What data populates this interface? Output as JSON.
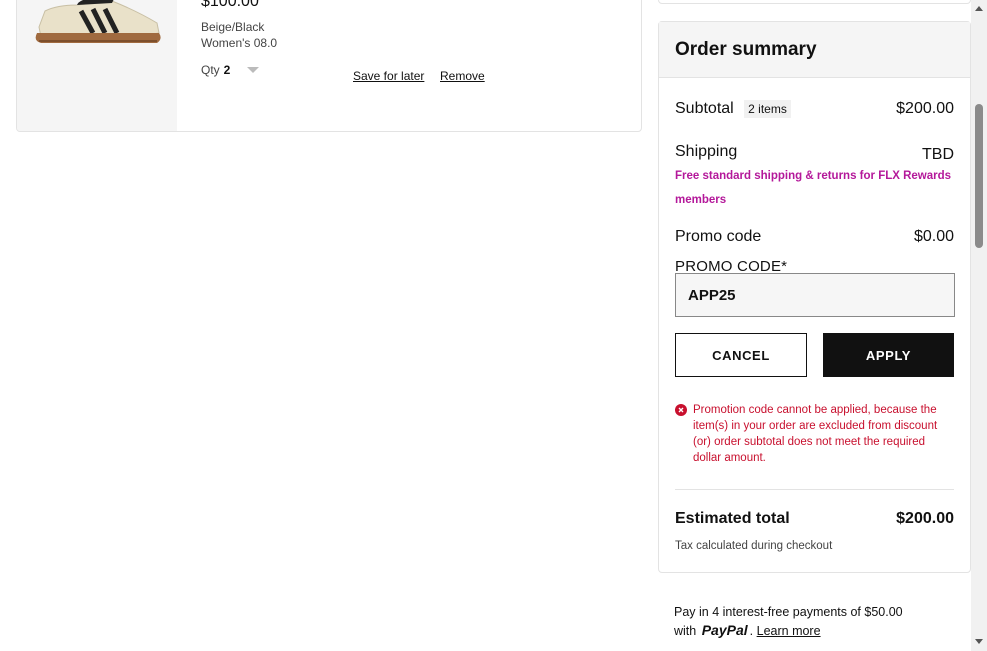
{
  "cart_item": {
    "price": "$100.00",
    "color": "Beige/Black",
    "size": "Women's 08.0",
    "qty_label": "Qty",
    "qty_value": "2",
    "save_for_later": "Save for later",
    "remove": "Remove"
  },
  "summary": {
    "title": "Order summary",
    "subtotal_label": "Subtotal",
    "items_badge": "2 items",
    "subtotal_value": "$200.00",
    "shipping_label": "Shipping",
    "shipping_value": "TBD",
    "free_shipping_msg": "Free standard shipping & returns for FLX Rewards members",
    "promo_label": "Promo code",
    "promo_value": "$0.00",
    "promo_field_label": "PROMO CODE*",
    "promo_input_value": "APP25",
    "cancel_label": "CANCEL",
    "apply_label": "APPLY",
    "error_msg": "Promotion code cannot be applied, because the item(s) in your order are excluded from discount (or) order subtotal does not meet the required dollar amount.",
    "estimated_total_label": "Estimated total",
    "estimated_total_value": "$200.00",
    "tax_note": "Tax calculated during checkout"
  },
  "paypal": {
    "line1": "Pay in 4 interest-free payments of $50.00",
    "with": "with",
    "logo": "PayPal",
    "learn_more": "Learn more"
  },
  "colors": {
    "accent_magenta": "#b4189a",
    "error_red": "#c8102e",
    "button_dark": "#111111"
  },
  "icons": [
    "sneaker-image",
    "chevron-down-icon",
    "error-circle-icon",
    "paypal-logo",
    "scroll-up-icon",
    "scroll-down-icon"
  ]
}
